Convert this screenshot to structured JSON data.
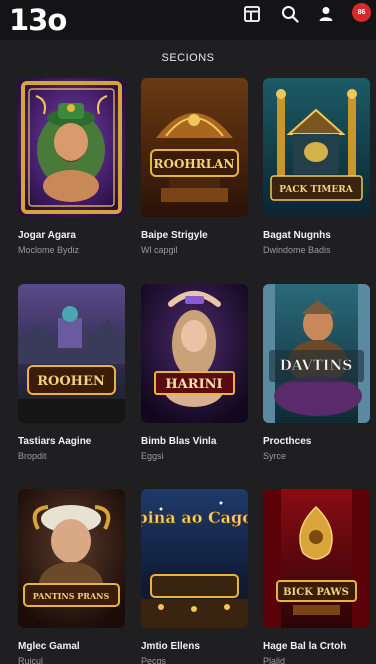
{
  "header": {
    "logo": "13o",
    "notification_count": "86"
  },
  "section": {
    "title": "SECIONS"
  },
  "games": [
    {
      "title": "Jogar Agara",
      "subtitle": "Moclome Bydiz",
      "art_text": ""
    },
    {
      "title": "Baipe Strigyle",
      "subtitle": "Wl capgil",
      "art_text": "ROOHRLAN"
    },
    {
      "title": "Bagat Nugnhs",
      "subtitle": "Dwindome Badis",
      "art_text": "PACK TIMERA"
    },
    {
      "title": "Tastiars Aagine",
      "subtitle": "Bropdit",
      "art_text": "ROOHEN"
    },
    {
      "title": "Bimb Blas Vinla",
      "subtitle": "Eggsi",
      "art_text": "HARINI"
    },
    {
      "title": "Procthces",
      "subtitle": "Syrce",
      "art_text": "DAVTINS"
    },
    {
      "title": "Mglec Gamal",
      "subtitle": "Ruicul",
      "art_text": "PANTINS PRANS"
    },
    {
      "title": "Jmtio Ellens",
      "subtitle": "Pecgs",
      "art_text": "Spina ao Cagoe"
    },
    {
      "title": "Hage Bal la Crtoh",
      "subtitle": "Plalid",
      "art_text": "BICK PAWS"
    }
  ],
  "colors": {
    "background": "#1f1f22",
    "topbar": "#141416",
    "badge": "#d92a2a",
    "subtitle": "#9a9a9e"
  }
}
